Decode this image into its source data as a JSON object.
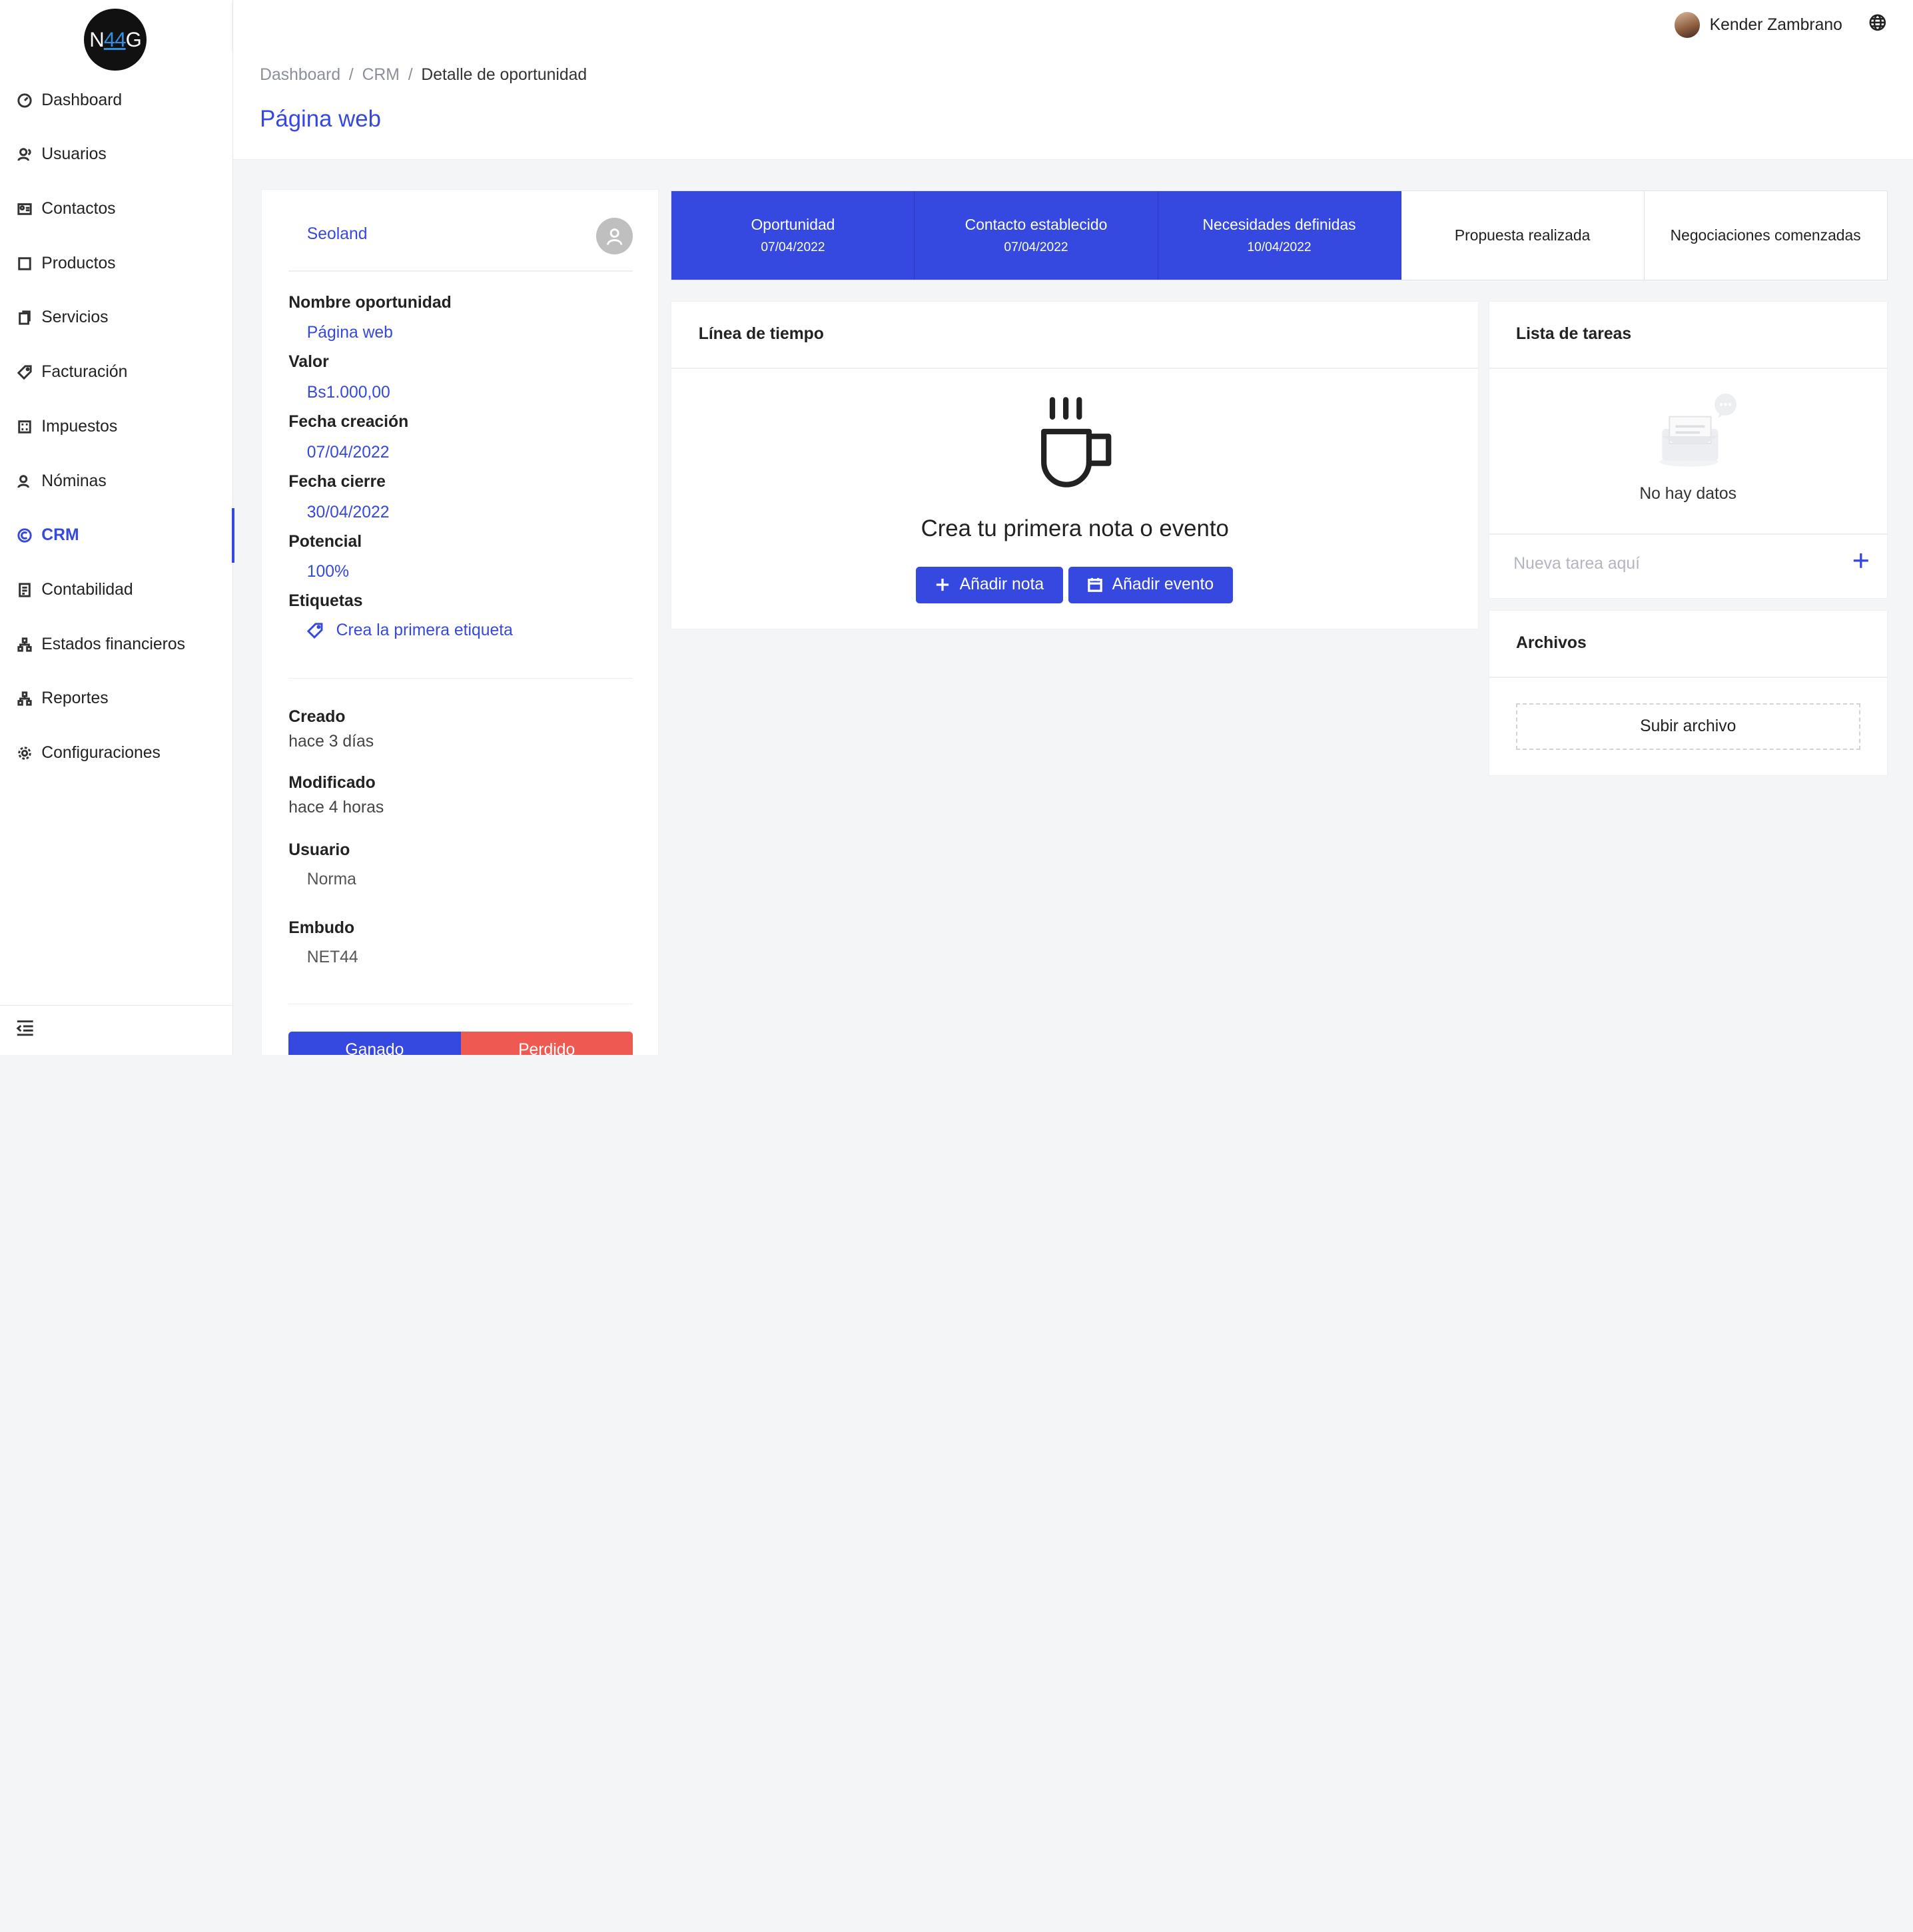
{
  "brand": {
    "logo_left": "N",
    "logo_mid": "44",
    "logo_right": "G"
  },
  "sidebar": {
    "items": [
      {
        "label": "Dashboard",
        "icon": "dashboard-icon"
      },
      {
        "label": "Usuarios",
        "icon": "users-icon"
      },
      {
        "label": "Contactos",
        "icon": "contacts-icon"
      },
      {
        "label": "Productos",
        "icon": "products-icon"
      },
      {
        "label": "Servicios",
        "icon": "services-icon"
      },
      {
        "label": "Facturación",
        "icon": "tag-icon"
      },
      {
        "label": "Impuestos",
        "icon": "taxes-icon"
      },
      {
        "label": "Nóminas",
        "icon": "payroll-icon"
      },
      {
        "label": "CRM",
        "icon": "crm-icon",
        "active": true
      },
      {
        "label": "Contabilidad",
        "icon": "accounting-icon"
      },
      {
        "label": "Estados financieros",
        "icon": "org-icon"
      },
      {
        "label": "Reportes",
        "icon": "reports-icon"
      },
      {
        "label": "Configuraciones",
        "icon": "gear-icon"
      }
    ]
  },
  "header": {
    "user_name": "Kender Zambrano"
  },
  "breadcrumb": {
    "items": [
      "Dashboard",
      "CRM"
    ],
    "current": "Detalle de oportunidad"
  },
  "page_title": "Página web",
  "detail": {
    "company": "Seoland",
    "fields": {
      "name_label": "Nombre oportunidad",
      "name_value": "Página web",
      "value_label": "Valor",
      "value_value": "Bs1.000,00",
      "created_label": "Fecha creación",
      "created_value": "07/04/2022",
      "close_label": "Fecha cierre",
      "close_value": "30/04/2022",
      "potential_label": "Potencial",
      "potential_value": "100%",
      "tags_label": "Etiquetas",
      "tags_link": "Crea la primera etiqueta"
    },
    "meta": {
      "creado_label": "Creado",
      "creado_value": "hace 3 días",
      "modificado_label": "Modificado",
      "modificado_value": "hace 4 horas",
      "usuario_label": "Usuario",
      "usuario_value": "Norma",
      "embudo_label": "Embudo",
      "embudo_value": "NET44"
    },
    "won_label": "Ganado",
    "lost_label": "Perdido"
  },
  "stages": [
    {
      "name": "Oportunidad",
      "date": "07/04/2022",
      "done": true
    },
    {
      "name": "Contacto establecido",
      "date": "07/04/2022",
      "done": true
    },
    {
      "name": "Necesidades definidas",
      "date": "10/04/2022",
      "done": true
    },
    {
      "name": "Propuesta realizada",
      "date": "",
      "done": false
    },
    {
      "name": "Negociaciones comenzadas",
      "date": "",
      "done": false
    }
  ],
  "timeline": {
    "title": "Línea de tiempo",
    "empty_message": "Crea tu primera nota o evento",
    "add_note": "Añadir nota",
    "add_event": "Añadir evento"
  },
  "tasks": {
    "title": "Lista de tareas",
    "empty": "No hay datos",
    "placeholder": "Nueva tarea aquí"
  },
  "files": {
    "title": "Archivos",
    "upload": "Subir archivo"
  },
  "colors": {
    "accent": "#3548e0",
    "danger": "#ee5a52"
  }
}
